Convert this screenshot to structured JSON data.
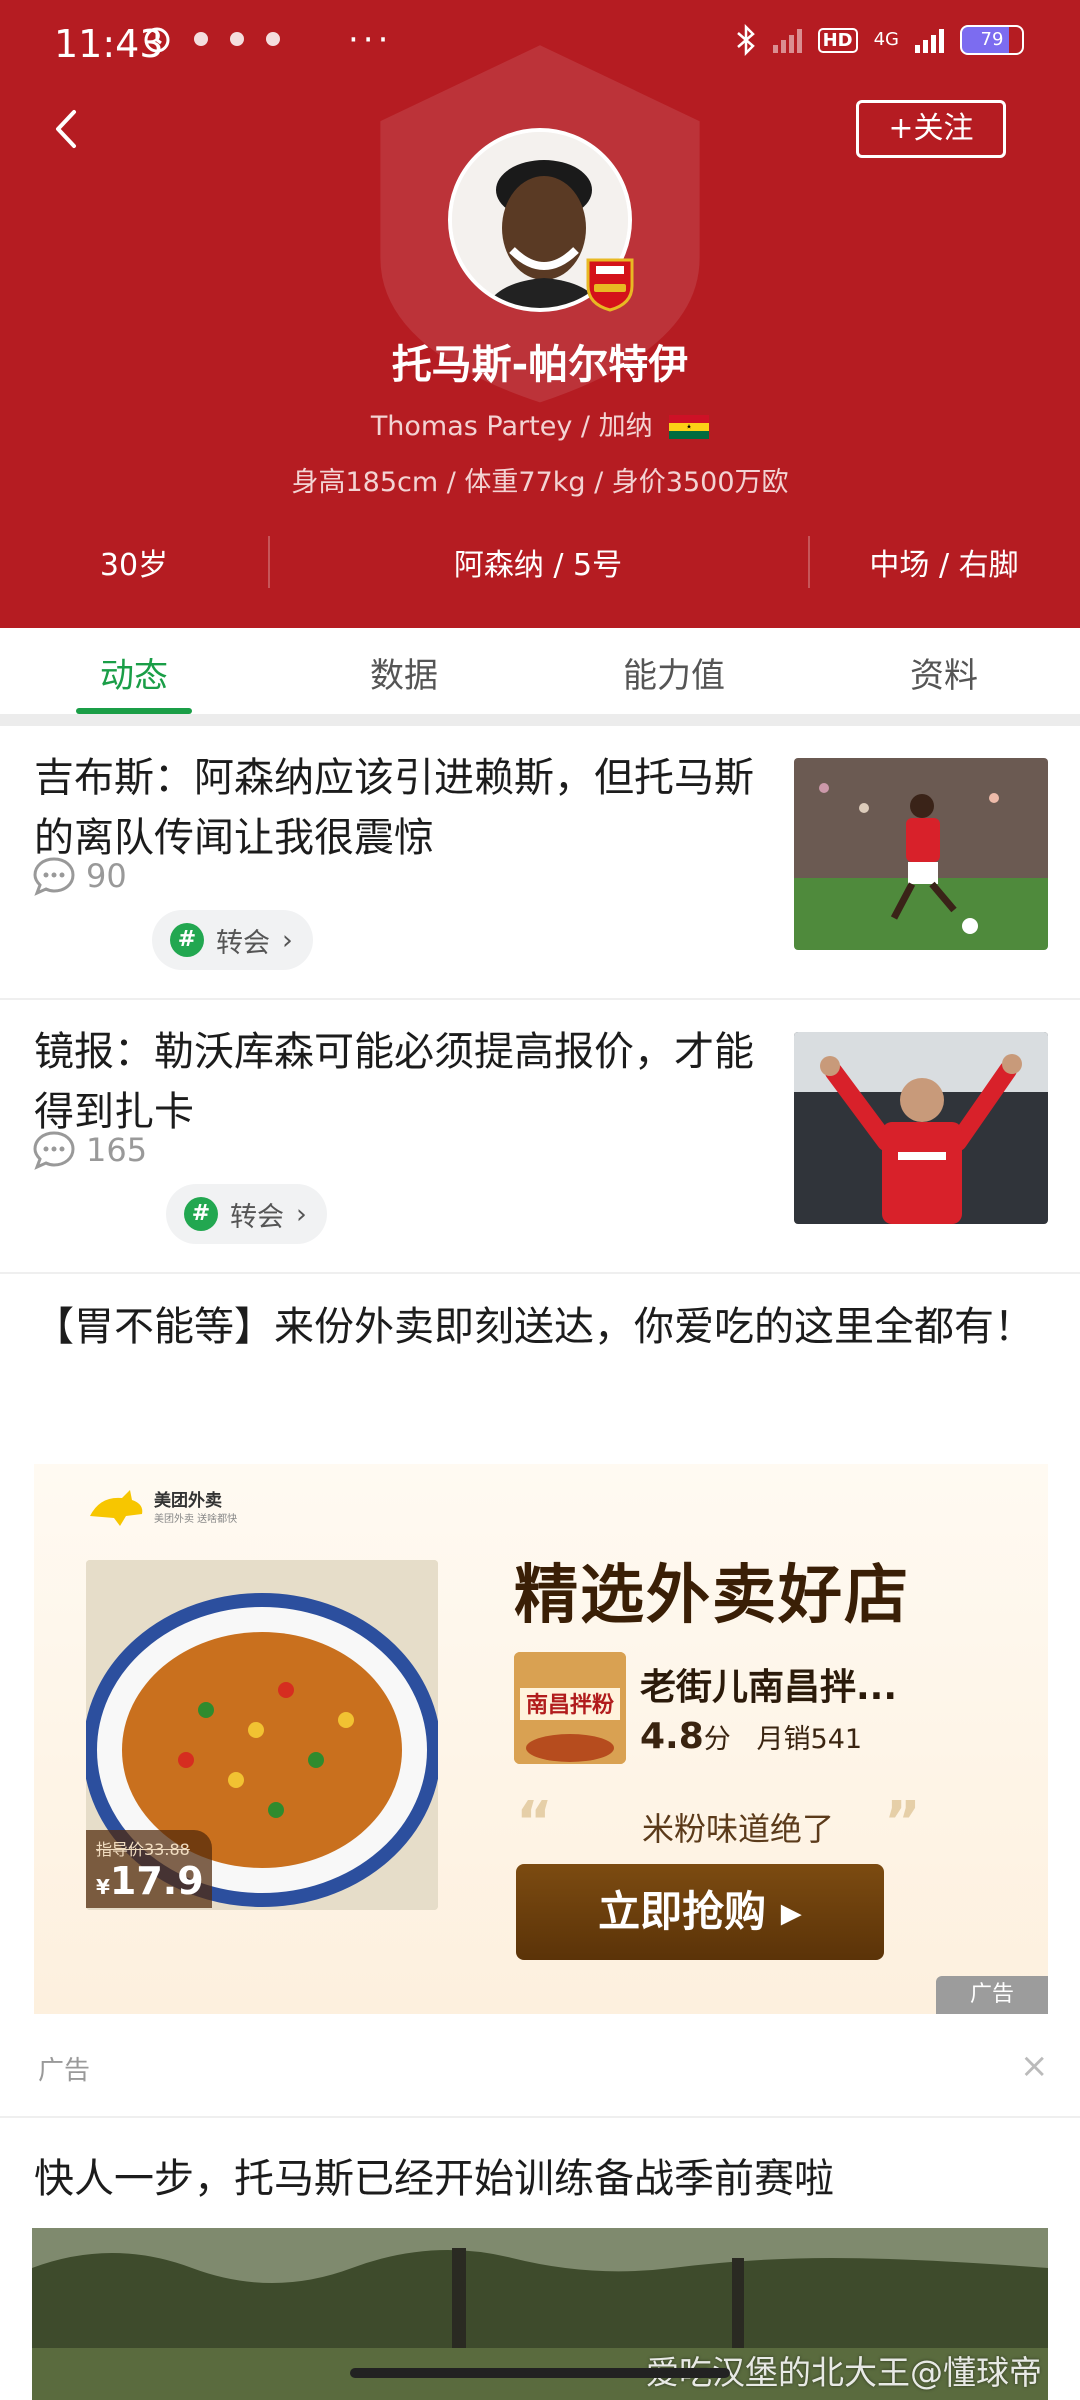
{
  "status_bar": {
    "time": "11:43",
    "network": "4G",
    "hd": "HD",
    "battery": "79"
  },
  "header": {
    "follow_label": "+关注",
    "player_name": "托马斯-帕尔特伊",
    "english_name_nationality": "Thomas Partey / 加纳",
    "bio": "身高185cm / 体重77kg / 身价3500万欧",
    "age": "30岁",
    "club_number": "阿森纳 / 5号",
    "position_foot": "中场 / 右脚",
    "colors": {
      "header_bg": "#b51c22",
      "accent": "#1a9e47"
    }
  },
  "tabs": [
    {
      "label": "动态",
      "active": true
    },
    {
      "label": "数据",
      "active": false
    },
    {
      "label": "能力值",
      "active": false
    },
    {
      "label": "资料",
      "active": false
    }
  ],
  "feed": [
    {
      "title": "吉布斯：阿森纳应该引进赖斯，但托马斯的离队传闻让我很震惊",
      "comments": "90",
      "tag": "转会"
    },
    {
      "title": "镜报：勒沃库森可能必须提高报价，才能得到扎卡",
      "comments": "165",
      "tag": "转会"
    }
  ],
  "ad": {
    "title": "【胃不能等】来份外卖即刻送达，你爱吃的这里全都有！",
    "brand": "美团外卖",
    "brand_sub": "美团外卖 送啥都快",
    "headline": "精选外卖好店",
    "shop_name": "老街儿南昌拌...",
    "shop_thumb_text": "南昌拌粉",
    "rating": "4.8",
    "rating_unit": "分",
    "monthly_sales": "月销541",
    "slogan": "米粉味道绝了",
    "cta": "立即抢购",
    "old_price": "指导价33.88",
    "new_price": "17.9",
    "currency": "¥",
    "ad_mark": "广告",
    "ad_label": "广告",
    "close": "×"
  },
  "news3": {
    "title": "快人一步，托马斯已经开始训练备战季前赛啦"
  },
  "watermark": "爱吃汉堡的北大王@懂球帝"
}
